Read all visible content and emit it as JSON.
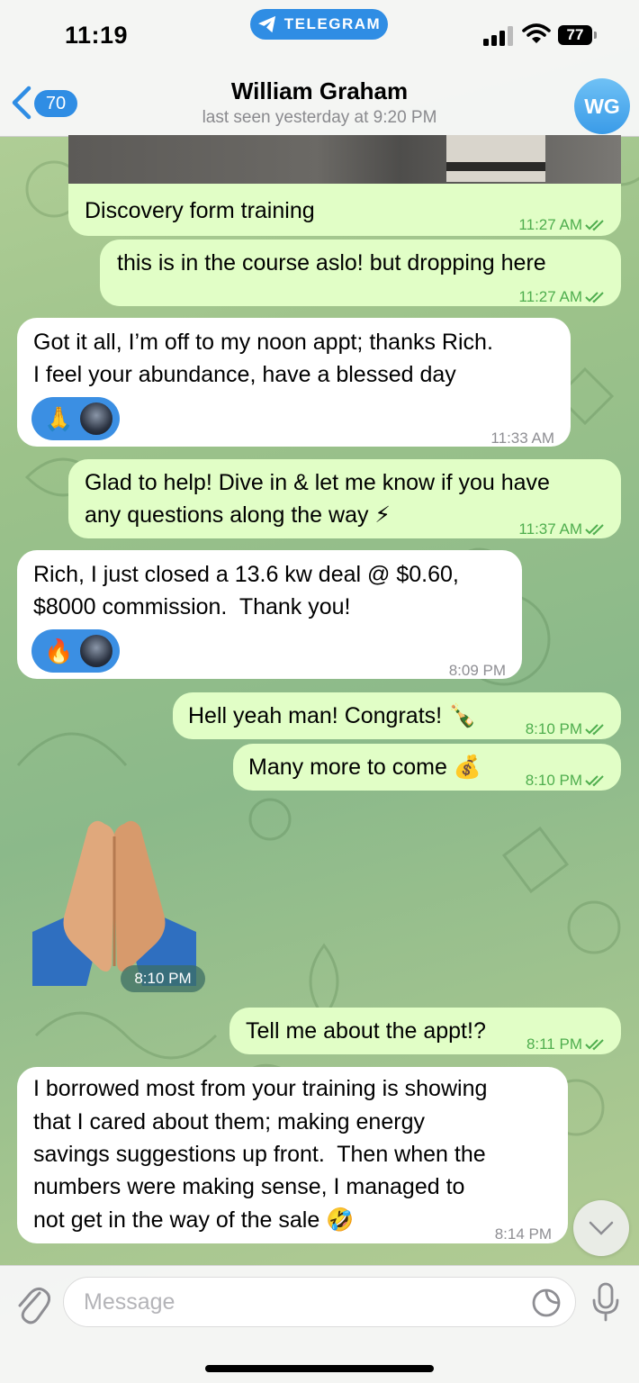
{
  "status_bar": {
    "time": "11:19",
    "app_pill": "TELEGRAM",
    "battery": "77"
  },
  "header": {
    "back_count": "70",
    "contact_name": "William Graham",
    "last_seen": "last seen yesterday at 9:20 PM",
    "avatar_initials": "WG"
  },
  "messages": [
    {
      "side": "out",
      "text": "Discovery form training",
      "time": "11:27 AM",
      "read": true,
      "media": "video"
    },
    {
      "side": "out",
      "text": "this is in the course aslo! but dropping here",
      "time": "11:27 AM",
      "read": true
    },
    {
      "side": "in",
      "lines": [
        "Got it all, I’m off to my noon appt; thanks Rich.",
        "I feel your abundance, have a blessed day"
      ],
      "time": "11:33 AM",
      "reaction": "🙏"
    },
    {
      "side": "out",
      "lines": [
        "Glad to help! Dive in & let me know if you have",
        "any questions along the way ⚡"
      ],
      "time": "11:37 AM",
      "read": true
    },
    {
      "side": "in",
      "lines": [
        "Rich, I just closed a 13.6 kw deal @ $0.60,",
        "$8000 commission.  Thank you!"
      ],
      "time": "8:09 PM",
      "reaction": "🔥"
    },
    {
      "side": "out",
      "text": "Hell yeah man! Congrats! 🍾",
      "time": "8:10 PM",
      "read": true
    },
    {
      "side": "out",
      "text": "Many more to come 💰",
      "time": "8:10 PM",
      "read": true
    },
    {
      "side": "in",
      "emoji": "🙏",
      "time": "8:10 PM"
    },
    {
      "side": "out",
      "text": "Tell me about the appt!?",
      "time": "8:11 PM",
      "read": true
    },
    {
      "side": "in",
      "lines": [
        "I borrowed most from your training is showing",
        "that I cared about them; making energy",
        "savings suggestions up front.  Then when the",
        "numbers were making sense, I managed to",
        "not get in the way of the sale 🤣"
      ],
      "time": "8:14 PM"
    }
  ],
  "composer": {
    "placeholder": "Message"
  },
  "icons": [
    "telegram-icon",
    "signal-icon",
    "wifi-icon",
    "battery-icon",
    "back-chevron-icon",
    "video-thumbnail",
    "double-check-icon",
    "folded-hands-emoji",
    "chevron-down-icon",
    "paperclip-icon",
    "sticker-icon",
    "microphone-icon"
  ],
  "colors": {
    "accent": "#2f8de4",
    "outgoing_bubble": "#e1fec6",
    "incoming_bubble": "#ffffff",
    "read_check": "#4fae4e"
  }
}
